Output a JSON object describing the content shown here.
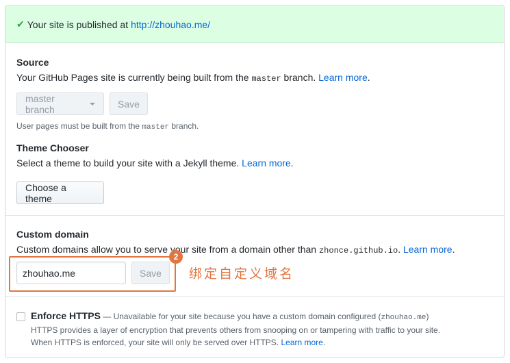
{
  "banner": {
    "check_glyph": "✔",
    "text": "Your site is published at ",
    "url": "http://zhouhao.me/"
  },
  "source": {
    "title": "Source",
    "desc_before": "Your GitHub Pages site is currently being built from the ",
    "branch_code": "master",
    "desc_after": " branch. ",
    "learn_more": "Learn more",
    "period": ".",
    "branch_select": "master branch",
    "save_label": "Save",
    "note_before": "User pages must be built from the ",
    "note_code": "master",
    "note_after": " branch."
  },
  "theme": {
    "title": "Theme Chooser",
    "desc": "Select a theme to build your site with a Jekyll theme. ",
    "learn_more": "Learn more",
    "period": ".",
    "button": "Choose a theme"
  },
  "custom_domain": {
    "title": "Custom domain",
    "desc": "Custom domains allow you to serve your site from a domain other than ",
    "domain_code": "zhonce.github.io",
    "period_space": ". ",
    "learn_more": "Learn more",
    "period": ".",
    "input_value": "zhouhao.me",
    "save_label": "Save"
  },
  "annotation": {
    "badge": "2",
    "text": "绑定自定义域名",
    "color": "#e3753f"
  },
  "https": {
    "title": "Enforce HTTPS",
    "dash_text": " — Unavailable for your site because you have a custom domain configured (",
    "domain_code": "zhouhao.me",
    "close_paren": ")",
    "line1": "HTTPS provides a layer of encryption that prevents others from snooping on or tampering with traffic to your site.",
    "line2": "When HTTPS is enforced, your site will only be served over HTTPS. ",
    "learn_more": "Learn more",
    "period": "."
  }
}
